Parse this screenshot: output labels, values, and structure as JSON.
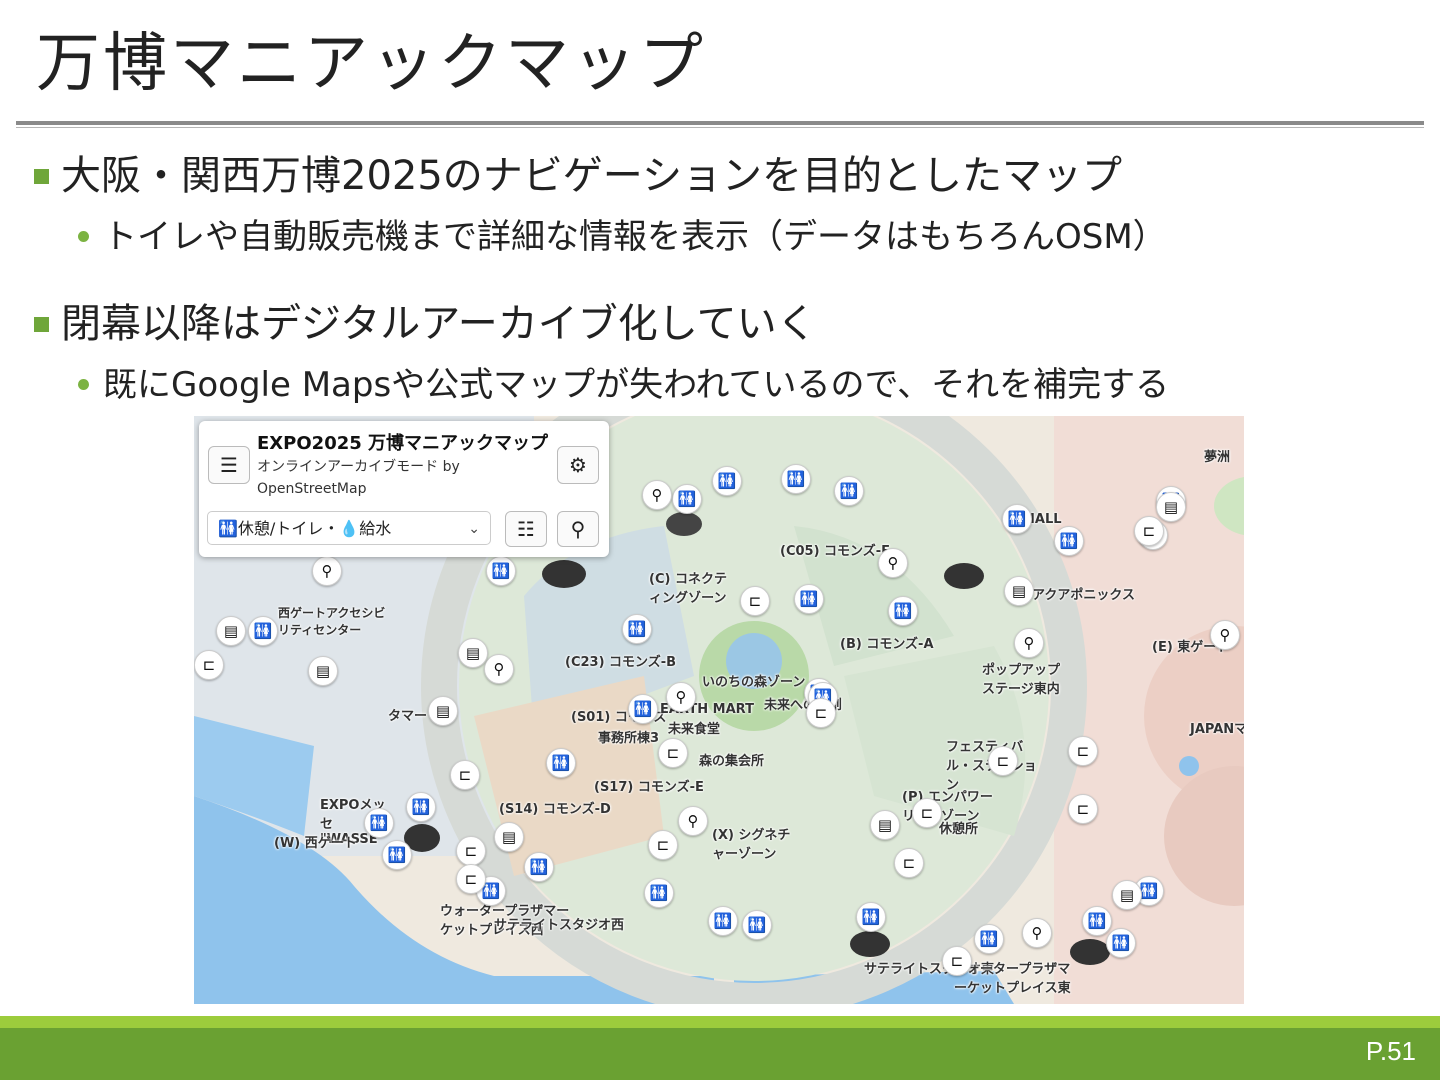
{
  "slide": {
    "title": "万博マニアックマップ",
    "bullets": [
      {
        "text": "大阪・関西万博2025のナビゲーションを目的としたマップ",
        "sub": [
          "トイレや自動販売機まで詳細な情報を表示（データはもちろんOSM）"
        ]
      },
      {
        "text": "閉幕以降はデジタルアーカイブ化していく",
        "sub": [
          "既にGoogle Mapsや公式マップが失われているので、それを補完する"
        ]
      }
    ],
    "page_number": "P.51"
  },
  "app": {
    "title": "EXPO2025 万博マニアックマップ",
    "subtitle": "オンラインアーカイブモード by OpenStreetMap",
    "menu_icon": "menu-icon",
    "settings_icon": "gear-icon",
    "layer_select": {
      "value": "🚻休憩/トイレ・💧給水"
    },
    "list_icon": "list-icon",
    "search_icon": "search-icon"
  },
  "map": {
    "labels": [
      "夢洲",
      "(C05) コモンズ-F",
      "(C) コネクティングゾーン",
      "西ゲートアクセシビリティセンター",
      "(C23) コモンズ-B",
      "(B) コモンズ-A",
      "(E) 東ゲート",
      "ポップアップステージ東内",
      "アクアポニックス",
      "(S01) コモンズ",
      "事務所棟3",
      "未来食堂",
      "森の集会所",
      "(S17) コモンズ-E",
      "(S14) コモンズ-D",
      "EXPOメッセ \"WASSE\"",
      "(W) 西ゲート",
      "(X) シグネチャーゾーン",
      "フェスティバル・ステーション",
      "(P) エンパワーリングゾーン",
      "休憩所",
      "ウォータープラザマーケットプレイス西",
      "サテライトスタジオ西",
      "サテライトスタジオ東",
      "ウォータープラザマーケットプレイス東",
      "JAPANマルシェ",
      "タマー",
      "いのちの森ゾーン",
      "未来への共創",
      "EARTH MART",
      "HALL"
    ]
  },
  "colors": {
    "accent_green": "#6fa63a",
    "footer_light": "#9ccc3c",
    "footer_dark": "#6aa132",
    "water": "#8fc3ec"
  }
}
